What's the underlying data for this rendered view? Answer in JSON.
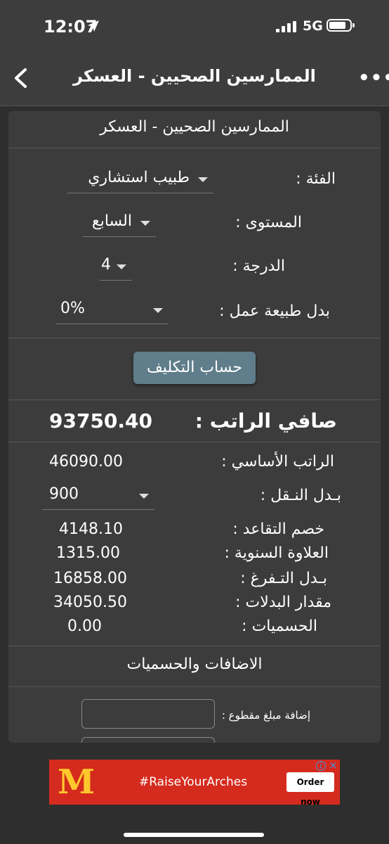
{
  "status_bar": {
    "time": "12:07",
    "network": "5G"
  },
  "nav": {
    "title": "الممارسين الصحيين - العسكر"
  },
  "card": {
    "title": "الممارسين الصحيين - العسكر",
    "category": {
      "label": "الفئة :",
      "value": "طبيب استشاري"
    },
    "level": {
      "label": "المستوى  :",
      "value": "السابع"
    },
    "grade": {
      "label": "الدرجة  :",
      "value": "4"
    },
    "work_allowance": {
      "label": "بدل طبيعة عمل  :",
      "value": "0%"
    },
    "calc_button": "حساب التكليف",
    "net_salary": {
      "label": "صافي الراتب :",
      "value": "93750.40"
    },
    "rows": [
      {
        "label": "الراتب الأساسي :",
        "value": "46090.00"
      },
      {
        "label": "بـدل النـقل :",
        "value": "900"
      },
      {
        "label": "خصم التقاعد :",
        "value": "4148.10"
      },
      {
        "label": "العلاوة السنوية :",
        "value": "1315.00"
      },
      {
        "label": "بـدل التـفرغ :",
        "value": "16858.00"
      },
      {
        "label": "مقدار البدلات :",
        "value": "34050.50"
      },
      {
        "label": "الحسميات :",
        "value": "0.00"
      }
    ],
    "additions_title": "الاضافات والحسميات",
    "lump_sum_label": "إضافة مبلغ مقطوع :"
  },
  "ad": {
    "text": "#RaiseYourArches",
    "button": "Order now"
  },
  "colors": {
    "button": "#607d8b",
    "ad_bg": "#d52b1e",
    "ad_logo": "#ffc72c"
  }
}
